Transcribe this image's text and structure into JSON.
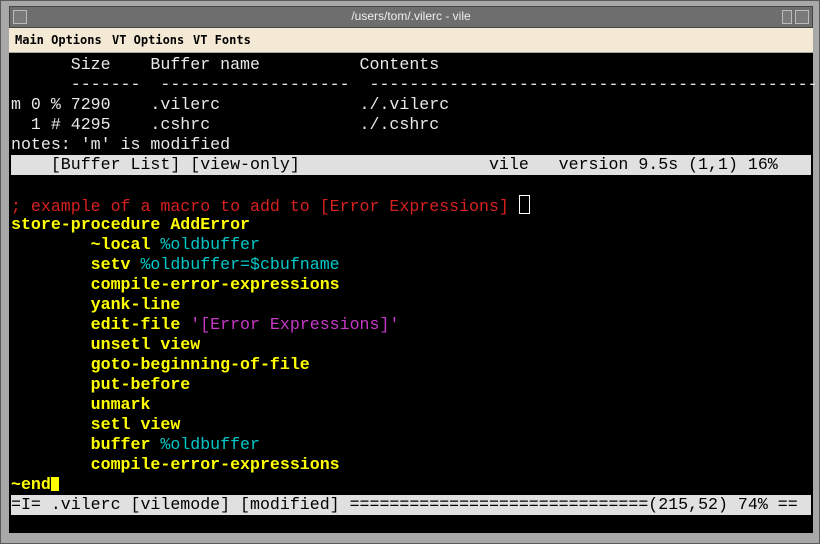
{
  "window": {
    "title": "/users/tom/.vilerc - vile"
  },
  "menu": [
    "Main Options",
    "VT Options",
    "VT Fonts"
  ],
  "buffer_list": {
    "header": "      Size    Buffer name          Contents",
    "dashes": "      -------  -------------------  ---------------------------------------------",
    "rows": [
      "m 0 % 7290    .vilerc              ./.vilerc",
      "  1 # 4295    .cshrc               ./.cshrc"
    ],
    "notes": "notes: 'm' is modified",
    "status": "    [Buffer List] [view-only]                   vile   version 9.5s (1,1) 16%"
  },
  "code": {
    "comment": "; example of a macro to add to [Error Expressions] ",
    "store": "store-procedure AddError",
    "l1a": "        ~local ",
    "l1b": "%oldbuffer",
    "l2a": "        setv ",
    "l2b": "%oldbuffer",
    "l2c": "=$cbufname",
    "l3": "        compile-error-expressions",
    "l4": "        yank-line",
    "l5a": "        edit-file ",
    "l5b": "'[Error Expressions]'",
    "l6": "        unsetl view",
    "l7": "        goto-beginning-of-file",
    "l8": "        put-before",
    "l9": "        unmark",
    "l10": "        setl view",
    "l11a": "        buffer ",
    "l11b": "%oldbuffer",
    "l12": "        compile-error-expressions",
    "end": "~end"
  },
  "status_line": "=I= .vilerc [vilemode] [modified] ==============================(215,52) 74% =="
}
